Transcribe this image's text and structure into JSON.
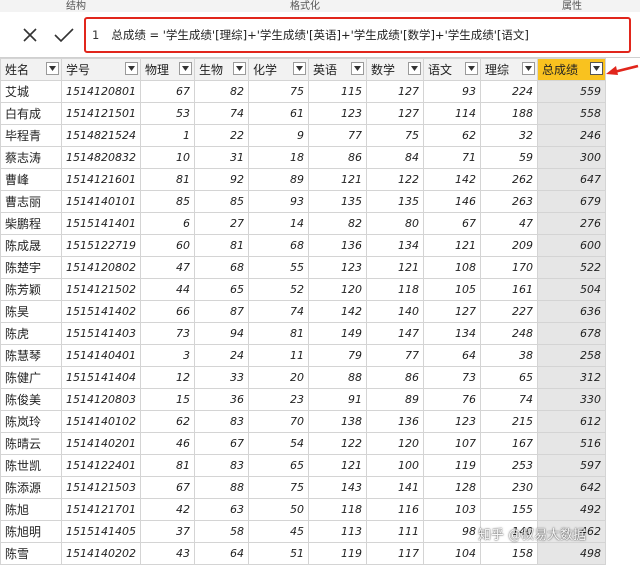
{
  "ribbon": {
    "groups": [
      "结构",
      "格式化",
      "属性"
    ]
  },
  "formula_bar": {
    "cancel_icon": "close-icon",
    "confirm_icon": "check-icon",
    "line_number": "1",
    "formula": "总成绩 = '学生成绩'[理综]+'学生成绩'[英语]+'学生成绩'[数学]+'学生成绩'[语文]"
  },
  "table": {
    "columns": [
      "姓名",
      "学号",
      "物理",
      "生物",
      "化学",
      "英语",
      "数学",
      "语文",
      "理综",
      "总成绩"
    ],
    "highlighted_column": "总成绩",
    "rows": [
      [
        "艾城",
        "1514120801",
        "67",
        "82",
        "75",
        "115",
        "127",
        "93",
        "224",
        "559"
      ],
      [
        "白有成",
        "1514121501",
        "53",
        "74",
        "61",
        "123",
        "127",
        "114",
        "188",
        "558"
      ],
      [
        "毕程青",
        "1514821524",
        "1",
        "22",
        "9",
        "77",
        "75",
        "62",
        "32",
        "246"
      ],
      [
        "蔡志涛",
        "1514820832",
        "10",
        "31",
        "18",
        "86",
        "84",
        "71",
        "59",
        "300"
      ],
      [
        "曹峰",
        "1514121601",
        "81",
        "92",
        "89",
        "121",
        "122",
        "142",
        "262",
        "647"
      ],
      [
        "曹志丽",
        "1514140101",
        "85",
        "85",
        "93",
        "135",
        "135",
        "146",
        "263",
        "679"
      ],
      [
        "柴鹏程",
        "1515141401",
        "6",
        "27",
        "14",
        "82",
        "80",
        "67",
        "47",
        "276"
      ],
      [
        "陈成晟",
        "1515122719",
        "60",
        "81",
        "68",
        "136",
        "134",
        "121",
        "209",
        "600"
      ],
      [
        "陈楚宇",
        "1514120802",
        "47",
        "68",
        "55",
        "123",
        "121",
        "108",
        "170",
        "522"
      ],
      [
        "陈芳颖",
        "1514121502",
        "44",
        "65",
        "52",
        "120",
        "118",
        "105",
        "161",
        "504"
      ],
      [
        "陈昊",
        "1515141402",
        "66",
        "87",
        "74",
        "142",
        "140",
        "127",
        "227",
        "636"
      ],
      [
        "陈虎",
        "1515141403",
        "73",
        "94",
        "81",
        "149",
        "147",
        "134",
        "248",
        "678"
      ],
      [
        "陈慧琴",
        "1514140401",
        "3",
        "24",
        "11",
        "79",
        "77",
        "64",
        "38",
        "258"
      ],
      [
        "陈健广",
        "1515141404",
        "12",
        "33",
        "20",
        "88",
        "86",
        "73",
        "65",
        "312"
      ],
      [
        "陈俊美",
        "1514120803",
        "15",
        "36",
        "23",
        "91",
        "89",
        "76",
        "74",
        "330"
      ],
      [
        "陈岚玲",
        "1514140102",
        "62",
        "83",
        "70",
        "138",
        "136",
        "123",
        "215",
        "612"
      ],
      [
        "陈晴云",
        "1514140201",
        "46",
        "67",
        "54",
        "122",
        "120",
        "107",
        "167",
        "516"
      ],
      [
        "陈世凯",
        "1514122401",
        "81",
        "83",
        "65",
        "121",
        "100",
        "119",
        "253",
        "597"
      ],
      [
        "陈添源",
        "1514121503",
        "67",
        "88",
        "75",
        "143",
        "141",
        "128",
        "230",
        "642"
      ],
      [
        "陈旭",
        "1514121701",
        "42",
        "63",
        "50",
        "118",
        "116",
        "103",
        "155",
        "492"
      ],
      [
        "陈旭明",
        "1515141405",
        "37",
        "58",
        "45",
        "113",
        "111",
        "98",
        "140",
        "462"
      ],
      [
        "陈雪",
        "1514140202",
        "43",
        "64",
        "51",
        "119",
        "117",
        "104",
        "158",
        "498"
      ]
    ]
  },
  "watermark": "知乎 @叔易大数据",
  "colors": {
    "formula_border": "#e1261c",
    "header_highlight": "#f9c21f",
    "total_column_bg": "#e6e6e6",
    "arrow": "#e1261c"
  }
}
